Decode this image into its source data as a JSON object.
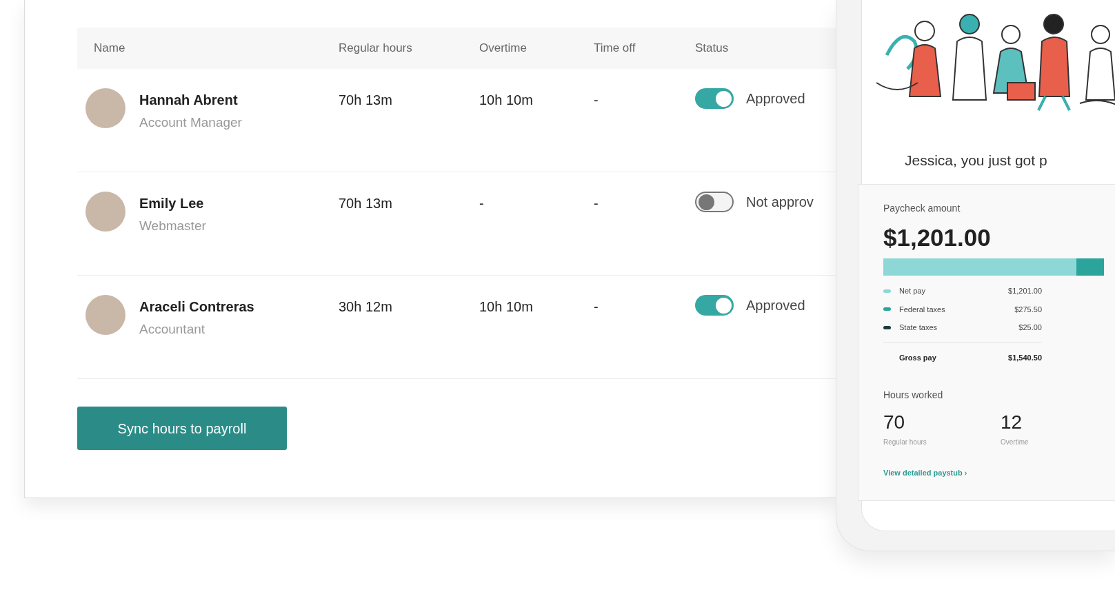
{
  "table": {
    "columns": [
      "Name",
      "Regular hours",
      "Overtime",
      "Time off",
      "Status"
    ],
    "rows": [
      {
        "name": "Hannah Abrent",
        "role": "Account Manager",
        "regular_hours": "70h 13m",
        "overtime": "10h 10m",
        "time_off": "-",
        "status": {
          "on": true,
          "label": "Approved"
        }
      },
      {
        "name": "Emily Lee",
        "role": "Webmaster",
        "regular_hours": "70h 13m",
        "overtime": "-",
        "time_off": "-",
        "status": {
          "on": false,
          "label": "Not approv"
        }
      },
      {
        "name": "Araceli Contreras",
        "role": "Accountant",
        "regular_hours": "30h 12m",
        "overtime": "10h 10m",
        "time_off": "-",
        "status": {
          "on": true,
          "label": "Approved"
        }
      }
    ]
  },
  "sync_button": "Sync hours to payroll",
  "phone": {
    "message": "Jessica, you just got p",
    "paycheck": {
      "label": "Paycheck amount",
      "amount": "$1,201.00",
      "breakdown": [
        {
          "label": "Net pay",
          "value": "$1,201.00",
          "color": "#8dd8d6"
        },
        {
          "label": "Federal taxes",
          "value": "$275.50",
          "color": "#2ba59c"
        },
        {
          "label": "State taxes",
          "value": "$25.00",
          "color": "#1d3b3a"
        }
      ],
      "total": {
        "label": "Gross pay",
        "value": "$1,540.50"
      }
    },
    "hours": {
      "title": "Hours worked",
      "stats": [
        {
          "value": "70",
          "label": "Regular hours"
        },
        {
          "value": "12",
          "label": "Overtime"
        }
      ]
    },
    "link": "View detailed paystub ›"
  }
}
